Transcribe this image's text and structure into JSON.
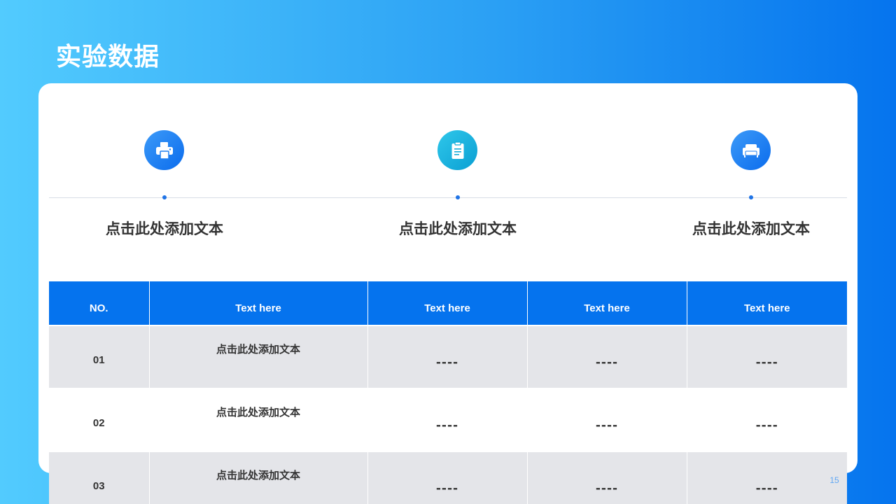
{
  "slide": {
    "title": "实验数据",
    "page_number": "15"
  },
  "features": [
    {
      "icon": "printer-icon",
      "label": "点击此处添加文本",
      "color": "#0b6ced"
    },
    {
      "icon": "clipboard-icon",
      "label": "点击此处添加文本",
      "color": "#0a9fd3"
    },
    {
      "icon": "sofa-icon",
      "label": "点击此处添加文本",
      "color": "#0b6ced"
    }
  ],
  "table": {
    "headers": [
      "NO.",
      "Text here",
      "Text here",
      "Text here",
      "Text here"
    ],
    "rows": [
      [
        "01",
        "点击此处添加文本",
        "----",
        "----",
        "----"
      ],
      [
        "02",
        "点击此处添加文本",
        "----",
        "----",
        "----"
      ],
      [
        "03",
        "点击此处添加文本",
        "----",
        "----",
        "----"
      ]
    ]
  },
  "colors": {
    "background_start": "#52cbfe",
    "background_end": "#0574ee",
    "table_header": "#0573ee",
    "row_shade": "#e4e5e9",
    "text_dark": "#333333"
  }
}
